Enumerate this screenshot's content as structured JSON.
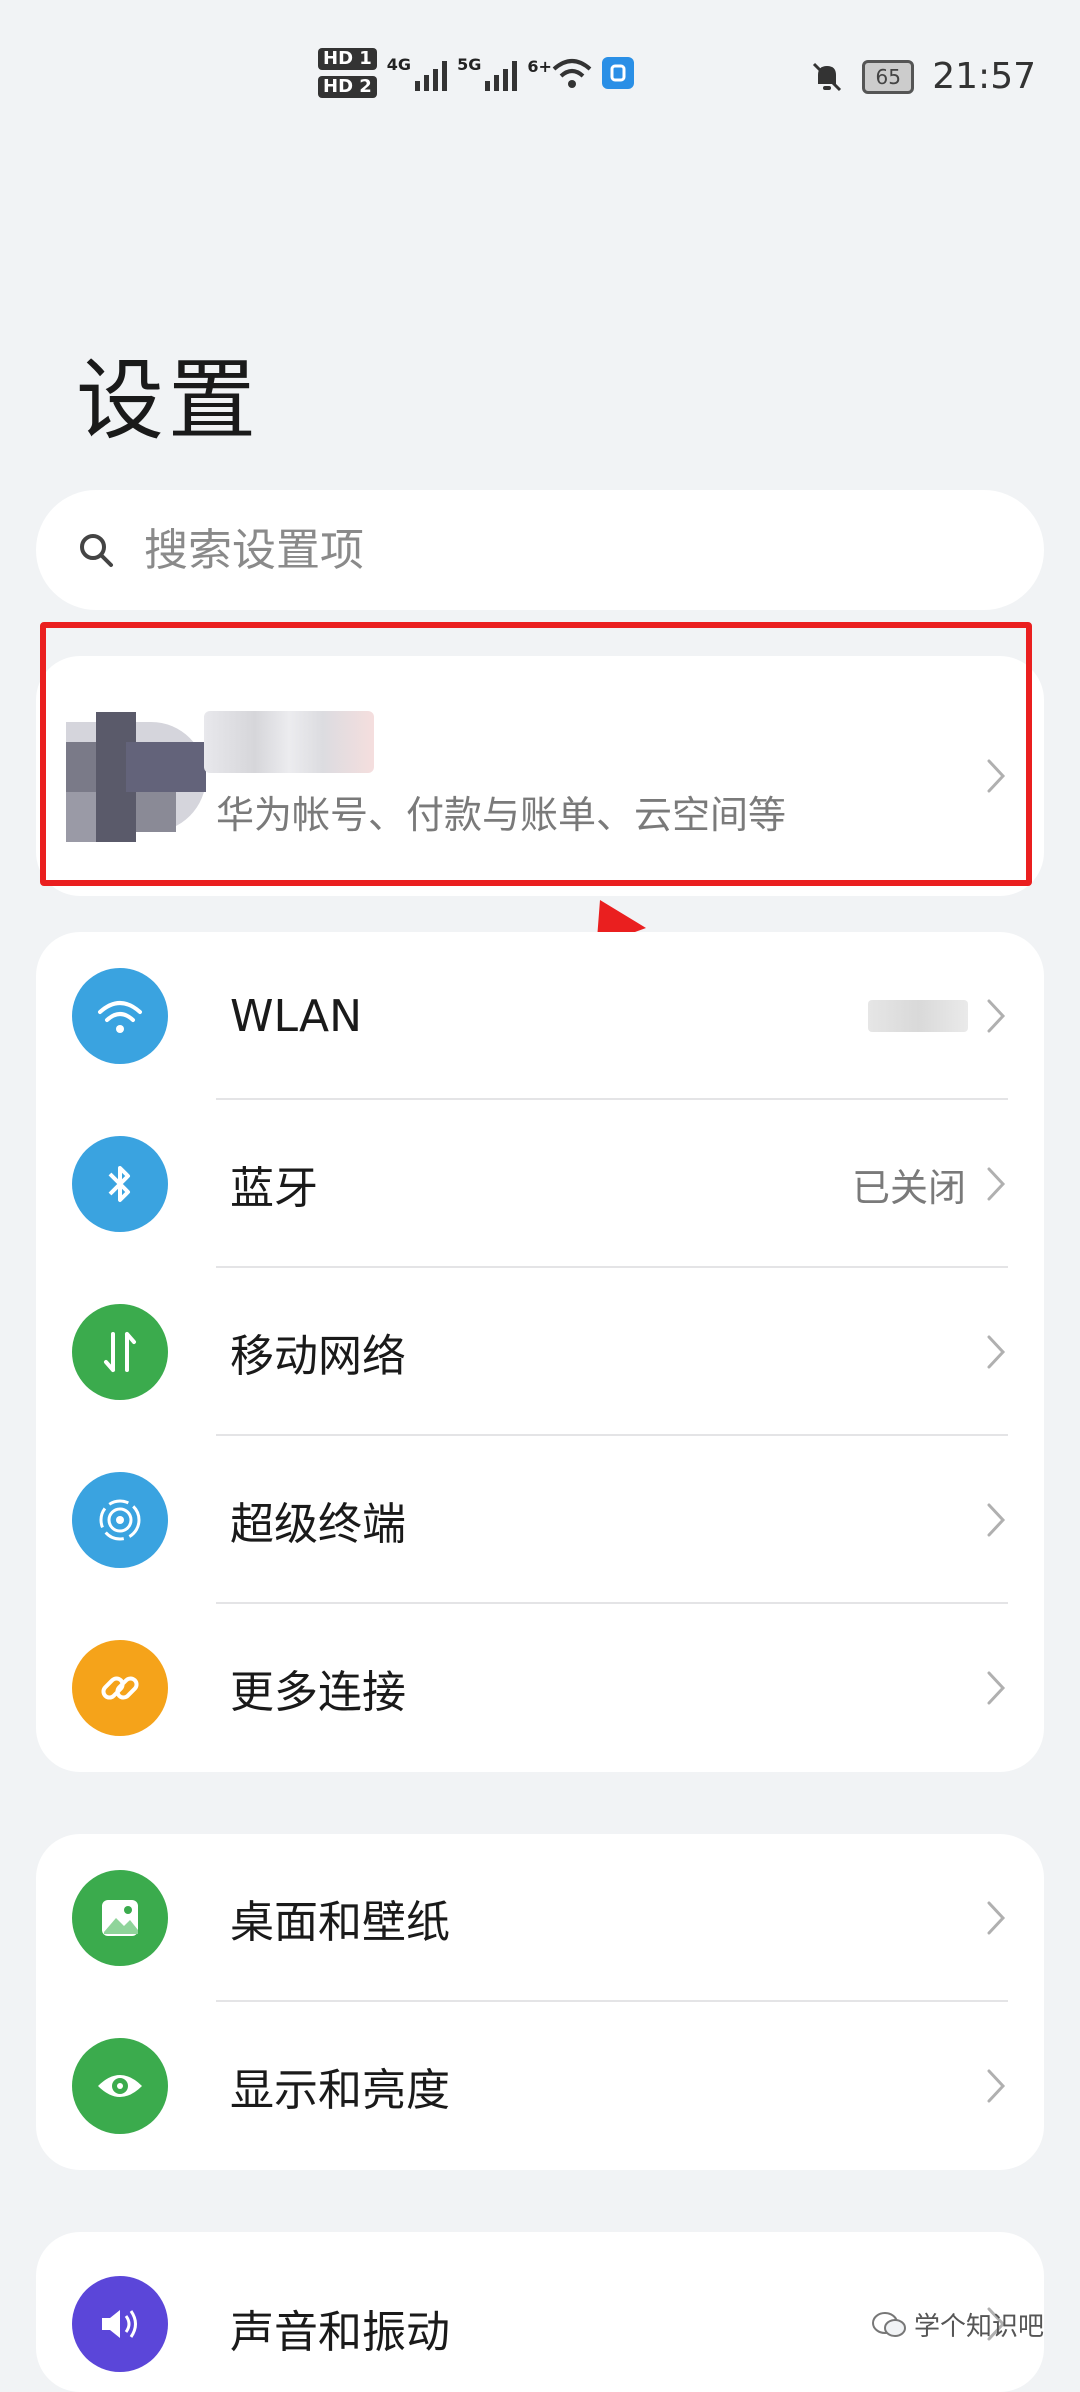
{
  "status_bar": {
    "hd1": "HD 1",
    "hd2": "HD 2",
    "net1": "4G",
    "net2": "5G",
    "wifi_tag": "6+",
    "battery": "65",
    "time": "21:57"
  },
  "page_title": "设置",
  "search": {
    "placeholder": "搜索设置项"
  },
  "account": {
    "subtitle": "华为帐号、付款与账单、云空间等"
  },
  "groups": [
    {
      "items": [
        {
          "label": "WLAN",
          "icon": "wifi-icon",
          "color": "#3aa3e0"
        },
        {
          "label": "蓝牙",
          "value": "已关闭",
          "icon": "bluetooth-icon",
          "color": "#3aa3e0"
        },
        {
          "label": "移动网络",
          "icon": "mobile-data-icon",
          "color": "#3bab4d"
        },
        {
          "label": "超级终端",
          "icon": "super-device-icon",
          "color": "#3aa3e0"
        },
        {
          "label": "更多连接",
          "icon": "link-icon",
          "color": "#f5a31a"
        }
      ]
    },
    {
      "items": [
        {
          "label": "桌面和壁纸",
          "icon": "wallpaper-icon",
          "color": "#3bab4d"
        },
        {
          "label": "显示和亮度",
          "icon": "eye-icon",
          "color": "#3bab4d"
        }
      ]
    },
    {
      "items": [
        {
          "label": "声音和振动",
          "icon": "sound-icon",
          "color": "#5b46d9"
        }
      ]
    }
  ],
  "watermark": "学个知识吧",
  "colors": {
    "highlight": "#ea1f1f",
    "background": "#f1f3f5"
  }
}
